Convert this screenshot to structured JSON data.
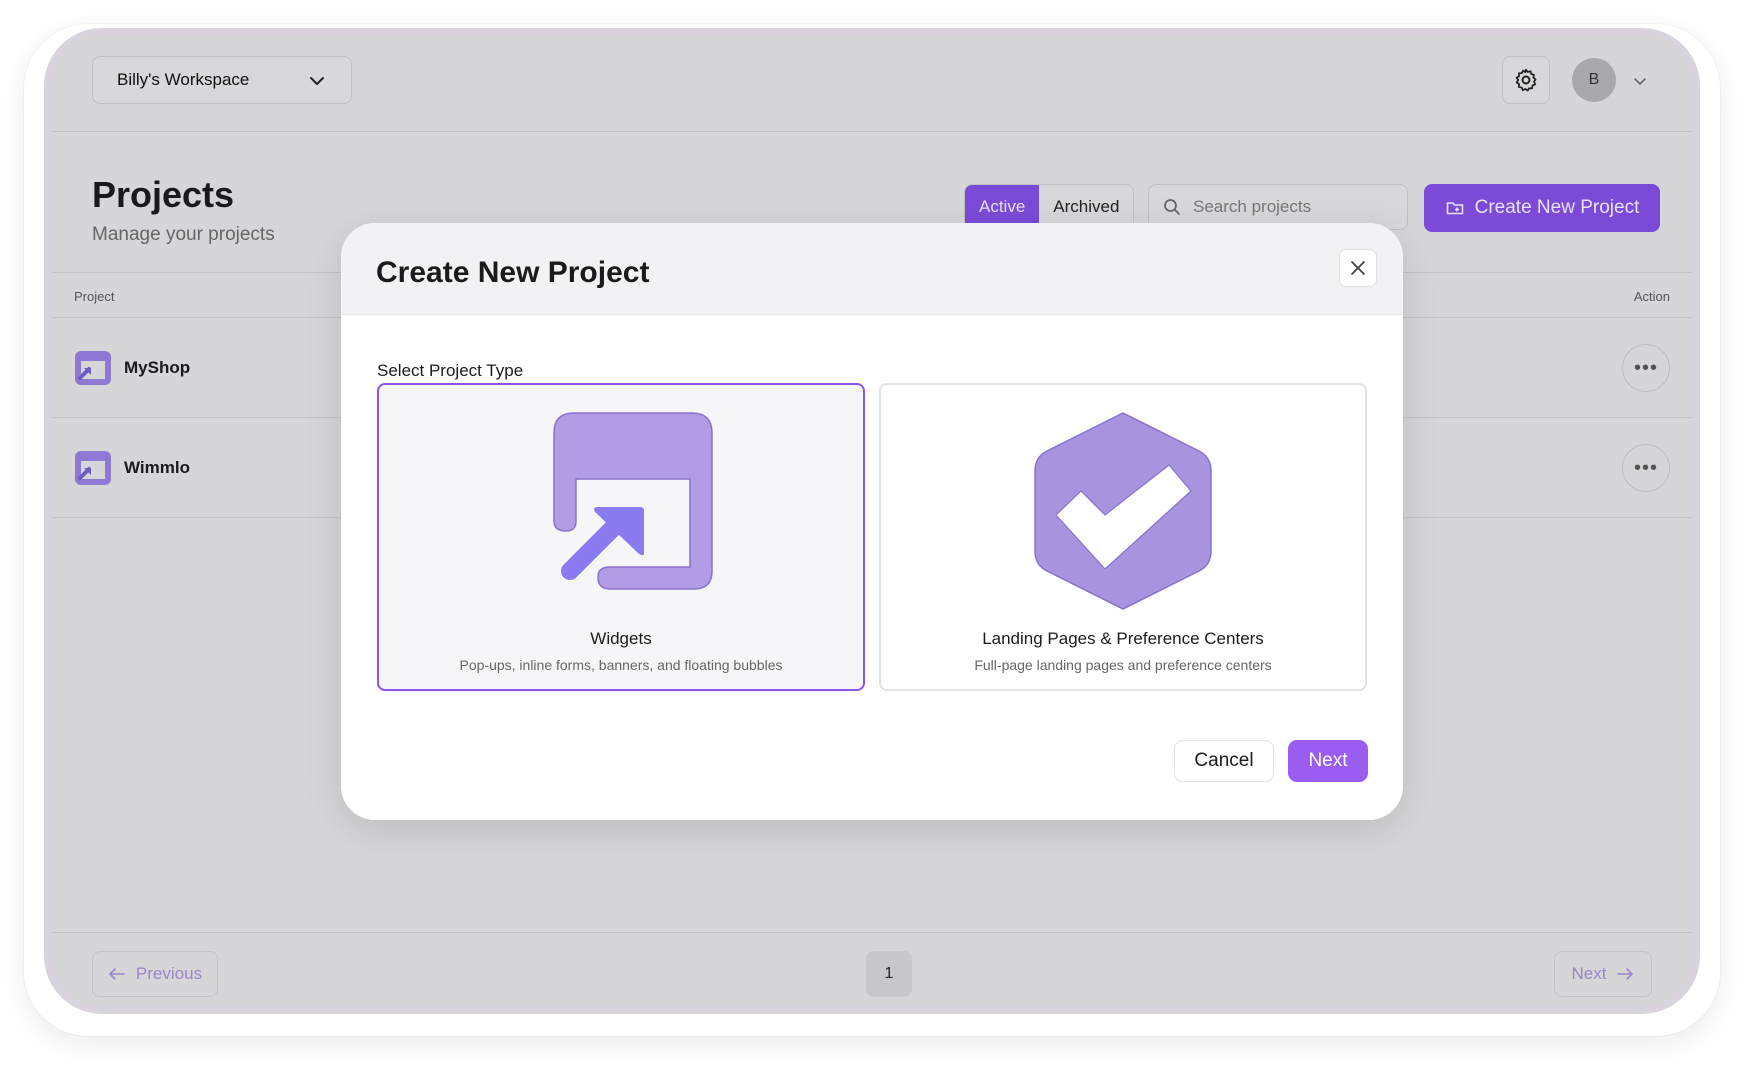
{
  "workspace": {
    "name": "Billy's Workspace"
  },
  "user": {
    "avatar_initial": "B"
  },
  "header": {
    "title": "Projects",
    "subtitle": "Manage your projects"
  },
  "filters": {
    "active_label": "Active",
    "archived_label": "Archived",
    "selected": "Active"
  },
  "search": {
    "placeholder": "Search projects",
    "value": ""
  },
  "create_button": {
    "label": "Create New Project"
  },
  "table": {
    "columns": [
      "Project",
      "Action"
    ],
    "rows": [
      {
        "name": "MyShop"
      },
      {
        "name": "Wimmlo"
      }
    ]
  },
  "pagination": {
    "previous_label": "Previous",
    "current_page": "1",
    "next_label": "Next"
  },
  "modal": {
    "title": "Create New Project",
    "section_label": "Select Project Type",
    "options": [
      {
        "title": "Widgets",
        "description": "Pop-ups, inline forms, banners, and floating bubbles",
        "icon": "widget-icon",
        "selected": true
      },
      {
        "title": "Landing Pages & Preference Centers",
        "description": "Full-page landing pages and preference centers",
        "icon": "badge-check-icon",
        "selected": false
      }
    ],
    "cancel_label": "Cancel",
    "next_label": "Next"
  },
  "colors": {
    "accent": "#7b4bd8",
    "accent_light": "#9b5cf2",
    "icon_fill": "#b39ce6",
    "arrow_fill": "#8a7cf0"
  }
}
